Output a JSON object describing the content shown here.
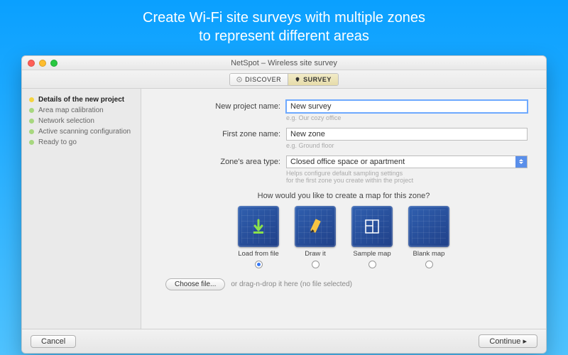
{
  "promo": {
    "line1": "Create Wi-Fi site surveys with multiple zones",
    "line2": "to represent different areas"
  },
  "window": {
    "title": "NetSpot – Wireless site survey"
  },
  "tabs": {
    "discover": "DISCOVER",
    "survey": "SURVEY"
  },
  "sidebar": {
    "items": [
      {
        "label": "Details of the new project",
        "active": true
      },
      {
        "label": "Area map calibration",
        "active": false
      },
      {
        "label": "Network selection",
        "active": false
      },
      {
        "label": "Active scanning configuration",
        "active": false
      },
      {
        "label": "Ready to go",
        "active": false
      }
    ]
  },
  "form": {
    "project_label": "New project name:",
    "project_value": "New survey",
    "project_hint": "e.g. Our cozy office",
    "zone_label": "First zone name:",
    "zone_value": "New zone",
    "zone_hint": "e.g. Ground floor",
    "area_label": "Zone's area type:",
    "area_value": "Closed office space or apartment",
    "area_hint1": "Helps configure default sampling settings",
    "area_hint2": "for the first zone you create within the project"
  },
  "map_section": {
    "question": "How would you like to create a map for this zone?",
    "options": [
      {
        "label": "Load from file",
        "selected": true
      },
      {
        "label": "Draw it",
        "selected": false
      },
      {
        "label": "Sample map",
        "selected": false
      },
      {
        "label": "Blank map",
        "selected": false
      }
    ],
    "choose_file": "Choose file...",
    "file_hint": "or drag-n-drop it here (no file selected)"
  },
  "footer": {
    "cancel": "Cancel",
    "continue": "Continue"
  }
}
